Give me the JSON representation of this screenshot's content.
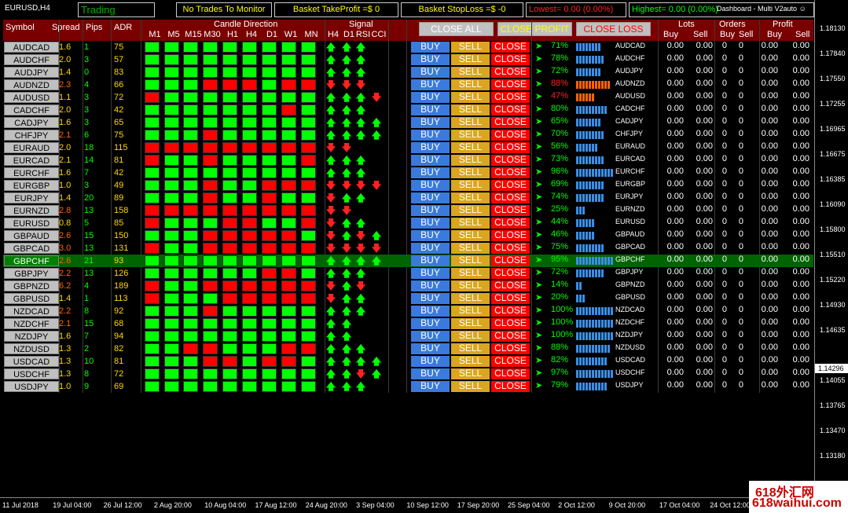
{
  "chart_symbol": "EURUSD,H4",
  "topbar": {
    "trading": "Trading",
    "status": "No Trades To Monitor",
    "take_profit": "Basket TakeProfit =$ 0",
    "stop_loss": "Basket StopLoss =$ -0",
    "lowest": "Lowest= 0.00 (0.00%)",
    "highest": "Highest= 0.00 (0.00%)",
    "ea_name": "Dashboard - Multi V2auto"
  },
  "header": {
    "symbol": "Symbol",
    "spread": "Spread",
    "pips": "Pips",
    "adr": "ADR",
    "candle_direction": "Candle Direction",
    "tf": [
      "M1",
      "M5",
      "M15",
      "M30",
      "H1",
      "H4",
      "D1",
      "W1",
      "MN"
    ],
    "signal": "Signal",
    "sig_cols": [
      "H4",
      "D1",
      "RSI",
      "CCI"
    ],
    "close_all": "CLOSE ALL",
    "close_profit": "CLOSE PROFIT",
    "close_loss": "CLOSE LOSS",
    "lots": "Lots",
    "orders": "Orders",
    "profit": "Profit",
    "buy": "Buy",
    "sell": "Sell"
  },
  "buttons": {
    "buy": "BUY",
    "sell": "SELL",
    "close": "CLOSE"
  },
  "colors": {
    "green": "#00ff00",
    "red": "#ff0000",
    "buy": "#3a7adc",
    "sell": "#daa520",
    "header": "#7a0000"
  },
  "rows": [
    {
      "symbol": "AUDCAD",
      "spread": "1.6",
      "spread_color": "yellow",
      "pips": "1",
      "adr": "75",
      "candles": "GGGGGGGGG",
      "signals": "UUU_",
      "pct": "71%",
      "pct_color": "green",
      "bars": 8,
      "bar_color": "blue",
      "label": "AUDCAD"
    },
    {
      "symbol": "AUDCHF",
      "spread": "2.0",
      "spread_color": "yellow",
      "pips": "3",
      "adr": "57",
      "candles": "GGGGGGGGG",
      "signals": "UUU_",
      "pct": "78%",
      "pct_color": "green",
      "bars": 9,
      "bar_color": "blue",
      "label": "AUDCHF"
    },
    {
      "symbol": "AUDJPY",
      "spread": "1.4",
      "spread_color": "yellow",
      "pips": "0",
      "adr": "83",
      "candles": "GGGGGGGGG",
      "signals": "UUU_",
      "pct": "72%",
      "pct_color": "green",
      "bars": 8,
      "bar_color": "blue",
      "label": "AUDJPY"
    },
    {
      "symbol": "AUDNZD",
      "spread": "2.3",
      "spread_color": "red",
      "pips": "4",
      "adr": "66",
      "candles": "GGGRRRGRR",
      "signals": "DDD_",
      "pct": "88%",
      "pct_color": "red",
      "bars": 11,
      "bar_color": "orange",
      "label": "AUDNZD"
    },
    {
      "symbol": "AUDUSD",
      "spread": "1.1",
      "spread_color": "yellow",
      "pips": "3",
      "adr": "72",
      "candles": "RGGGGGGGG",
      "signals": "UUUD",
      "pct": "47%",
      "pct_color": "red",
      "bars": 6,
      "bar_color": "orange",
      "label": "AUDUSD"
    },
    {
      "symbol": "CADCHF",
      "spread": "2.0",
      "spread_color": "yellow",
      "pips": "3",
      "adr": "42",
      "candles": "GGGGGGGRG",
      "signals": "UUU_",
      "pct": "80%",
      "pct_color": "green",
      "bars": 10,
      "bar_color": "blue",
      "label": "CADCHF"
    },
    {
      "symbol": "CADJPY",
      "spread": "1.6",
      "spread_color": "yellow",
      "pips": "3",
      "adr": "65",
      "candles": "GGGGGGGGG",
      "signals": "UUUU",
      "pct": "65%",
      "pct_color": "green",
      "bars": 8,
      "bar_color": "blue",
      "label": "CADJPY"
    },
    {
      "symbol": "CHFJPY",
      "spread": "2.1",
      "spread_color": "red",
      "pips": "6",
      "adr": "75",
      "candles": "GGGRGGGGG",
      "signals": "UUUU",
      "pct": "70%",
      "pct_color": "green",
      "bars": 9,
      "bar_color": "blue",
      "label": "CHFJPY"
    },
    {
      "symbol": "EURAUD",
      "spread": "2.0",
      "spread_color": "yellow",
      "pips": "18",
      "adr": "115",
      "candles": "RRRRRRRRR",
      "signals": "DD__",
      "pct": "56%",
      "pct_color": "green",
      "bars": 7,
      "bar_color": "blue",
      "label": "EURAUD"
    },
    {
      "symbol": "EURCAD",
      "spread": "2.1",
      "spread_color": "yellow",
      "pips": "14",
      "adr": "81",
      "candles": "RGGRGGGGR",
      "signals": "UUU_",
      "pct": "73%",
      "pct_color": "green",
      "bars": 9,
      "bar_color": "blue",
      "label": "EURCAD"
    },
    {
      "symbol": "EURCHF",
      "spread": "1.6",
      "spread_color": "yellow",
      "pips": "7",
      "adr": "42",
      "candles": "GGGGGGGGG",
      "signals": "UUU_",
      "pct": "96%",
      "pct_color": "green",
      "bars": 12,
      "bar_color": "blue",
      "label": "EURCHF"
    },
    {
      "symbol": "EURGBP",
      "spread": "1.0",
      "spread_color": "yellow",
      "pips": "3",
      "adr": "49",
      "candles": "GGGRGGRRR",
      "signals": "DDDD",
      "pct": "69%",
      "pct_color": "green",
      "bars": 9,
      "bar_color": "blue",
      "label": "EURGBP"
    },
    {
      "symbol": "EURJPY",
      "spread": "1.4",
      "spread_color": "yellow",
      "pips": "20",
      "adr": "89",
      "candles": "GGGRGGRGG",
      "signals": "DUU_",
      "pct": "74%",
      "pct_color": "green",
      "bars": 9,
      "bar_color": "blue",
      "label": "EURJPY"
    },
    {
      "symbol": "EURNZD",
      "spread": "2.8",
      "spread_color": "red",
      "pips": "13",
      "adr": "158",
      "candles": "RRRRRRRRR",
      "signals": "DD__",
      "pct": "25%",
      "pct_color": "green",
      "bars": 3,
      "bar_color": "blue",
      "label": "EURNZD"
    },
    {
      "symbol": "EURUSD",
      "spread": "0.8",
      "spread_color": "yellow",
      "pips": "5",
      "adr": "85",
      "candles": "RGGGRRGGR",
      "signals": "DUU_",
      "pct": "44%",
      "pct_color": "green",
      "bars": 6,
      "bar_color": "blue",
      "label": "EURUSD"
    },
    {
      "symbol": "GBPAUD",
      "spread": "2.6",
      "spread_color": "red",
      "pips": "15",
      "adr": "150",
      "candles": "GGGRRRRRG",
      "signals": "DUDU",
      "pct": "46%",
      "pct_color": "green",
      "bars": 6,
      "bar_color": "blue",
      "label": "GBPAUD"
    },
    {
      "symbol": "GBPCAD",
      "spread": "3.0",
      "spread_color": "red",
      "pips": "13",
      "adr": "131",
      "candles": "RGGRRRRRR",
      "signals": "DDDD",
      "pct": "75%",
      "pct_color": "green",
      "bars": 9,
      "bar_color": "blue",
      "label": "GBPCAD"
    },
    {
      "symbol": "GBPCHF",
      "spread": "2.6",
      "spread_color": "red",
      "pips": "21",
      "adr": "93",
      "candles": "GGGGGGGGG",
      "signals": "UUUU",
      "pct": "95%",
      "pct_color": "green",
      "bars": 12,
      "bar_color": "blue",
      "label": "GBPCHF",
      "highlight": true
    },
    {
      "symbol": "GBPJPY",
      "spread": "2.2",
      "spread_color": "red",
      "pips": "13",
      "adr": "126",
      "candles": "GGGGGGRRG",
      "signals": "UUU_",
      "pct": "72%",
      "pct_color": "green",
      "bars": 9,
      "bar_color": "blue",
      "label": "GBPJPY"
    },
    {
      "symbol": "GBPNZD",
      "spread": "6.2",
      "spread_color": "red",
      "pips": "4",
      "adr": "189",
      "candles": "RGGRRRRRR",
      "signals": "DUD_",
      "pct": "14%",
      "pct_color": "green",
      "bars": 2,
      "bar_color": "blue",
      "label": "GBPNZD"
    },
    {
      "symbol": "GBPUSD",
      "spread": "1.4",
      "spread_color": "yellow",
      "pips": "1",
      "adr": "113",
      "candles": "RGGGRRRRR",
      "signals": "DUU_",
      "pct": "20%",
      "pct_color": "green",
      "bars": 3,
      "bar_color": "blue",
      "label": "GBPUSD"
    },
    {
      "symbol": "NZDCAD",
      "spread": "2.2",
      "spread_color": "red",
      "pips": "8",
      "adr": "92",
      "candles": "GGGRGGGGG",
      "signals": "UUU_",
      "pct": "100%",
      "pct_color": "green",
      "bars": 12,
      "bar_color": "blue",
      "label": "NZDCAD"
    },
    {
      "symbol": "NZDCHF",
      "spread": "2.1",
      "spread_color": "red",
      "pips": "15",
      "adr": "68",
      "candles": "GGGGGGGGG",
      "signals": "UU__",
      "pct": "100%",
      "pct_color": "green",
      "bars": 12,
      "bar_color": "blue",
      "label": "NZDCHF"
    },
    {
      "symbol": "NZDJPY",
      "spread": "1.6",
      "spread_color": "yellow",
      "pips": "7",
      "adr": "94",
      "candles": "GGGGGGGGG",
      "signals": "UU__",
      "pct": "100%",
      "pct_color": "green",
      "bars": 12,
      "bar_color": "blue",
      "label": "NZDJPY"
    },
    {
      "symbol": "NZDUSD",
      "spread": "1.3",
      "spread_color": "yellow",
      "pips": "2",
      "adr": "82",
      "candles": "GGRRGGGRR",
      "signals": "UUU_",
      "pct": "88%",
      "pct_color": "green",
      "bars": 11,
      "bar_color": "blue",
      "label": "NZDUSD"
    },
    {
      "symbol": "USDCAD",
      "spread": "1.3",
      "spread_color": "yellow",
      "pips": "10",
      "adr": "81",
      "candles": "GGGRRGRRG",
      "signals": "UUUU",
      "pct": "82%",
      "pct_color": "green",
      "bars": 10,
      "bar_color": "blue",
      "label": "USDCAD"
    },
    {
      "symbol": "USDCHF",
      "spread": "1.3",
      "spread_color": "yellow",
      "pips": "8",
      "adr": "72",
      "candles": "GGGGGGGGG",
      "signals": "UUDU",
      "pct": "97%",
      "pct_color": "green",
      "bars": 12,
      "bar_color": "blue",
      "label": "USDCHF"
    },
    {
      "symbol": "USDJPY",
      "spread": "1.0",
      "spread_color": "yellow",
      "pips": "9",
      "adr": "69",
      "candles": "GGGGGGGGG",
      "signals": "UUU_",
      "pct": "79%",
      "pct_color": "green",
      "bars": 10,
      "bar_color": "blue",
      "label": "USDJPY"
    }
  ],
  "zero": "0.00",
  "zero_int": "0",
  "price_scale": [
    "1.18130",
    "1.17840",
    "1.17550",
    "1.17255",
    "1.16965",
    "1.16675",
    "1.16385",
    "1.16090",
    "1.15800",
    "1.15510",
    "1.15220",
    "1.14930",
    "1.14635",
    "1.14296",
    "1.14055",
    "1.13765",
    "1.13470",
    "1.13180"
  ],
  "current_price": "1.14296",
  "time_scale": [
    "11 Jul 2018",
    "19 Jul 04:00",
    "26 Jul 12:00",
    "2 Aug 20:00",
    "10 Aug 04:00",
    "17 Aug 12:00",
    "24 Aug 20:00",
    "3 Sep 04:00",
    "10 Sep 12:00",
    "17 Sep 20:00",
    "25 Sep 04:00",
    "2 Oct 12:00",
    "9 Oct 20:00",
    "17 Oct 04:00",
    "24 Oct 12:00"
  ],
  "watermark": {
    "line1": "618外汇网",
    "line2": "618waihui.com"
  }
}
